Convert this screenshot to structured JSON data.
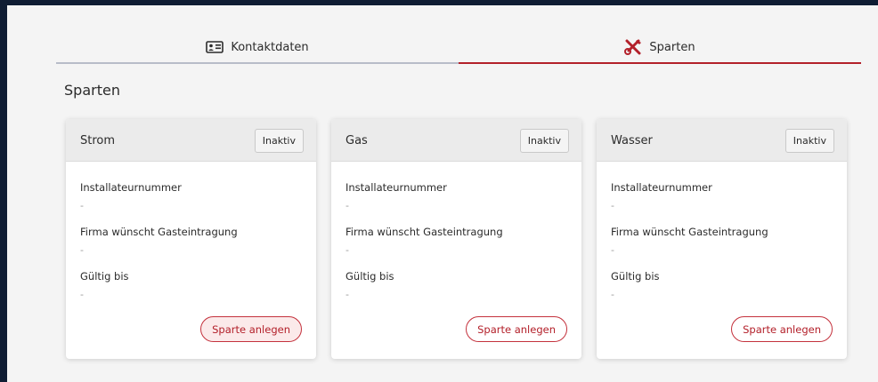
{
  "tabs": [
    {
      "label": "Kontaktdaten",
      "icon": "contact-card-icon",
      "active": false
    },
    {
      "label": "Sparten",
      "icon": "tools-icon",
      "active": true
    }
  ],
  "page": {
    "title": "Sparten"
  },
  "colors": {
    "accent": "#b3202a",
    "tab_inactive_underline": "#b8bcc8",
    "card_header": "#ebebeb"
  },
  "cards": [
    {
      "title": "Strom",
      "status": "Inaktiv",
      "fields": [
        {
          "label": "Installateurnummer",
          "value": "-"
        },
        {
          "label": "Firma wünscht Gasteintragung",
          "value": "-"
        },
        {
          "label": "Gültig bis",
          "value": "-"
        }
      ],
      "action": "Sparte anlegen"
    },
    {
      "title": "Gas",
      "status": "Inaktiv",
      "fields": [
        {
          "label": "Installateurnummer",
          "value": "-"
        },
        {
          "label": "Firma wünscht Gasteintragung",
          "value": "-"
        },
        {
          "label": "Gültig bis",
          "value": "-"
        }
      ],
      "action": "Sparte anlegen"
    },
    {
      "title": "Wasser",
      "status": "Inaktiv",
      "fields": [
        {
          "label": "Installateurnummer",
          "value": "-"
        },
        {
          "label": "Firma wünscht Gasteintragung",
          "value": "-"
        },
        {
          "label": "Gültig bis",
          "value": "-"
        }
      ],
      "action": "Sparte anlegen"
    }
  ]
}
